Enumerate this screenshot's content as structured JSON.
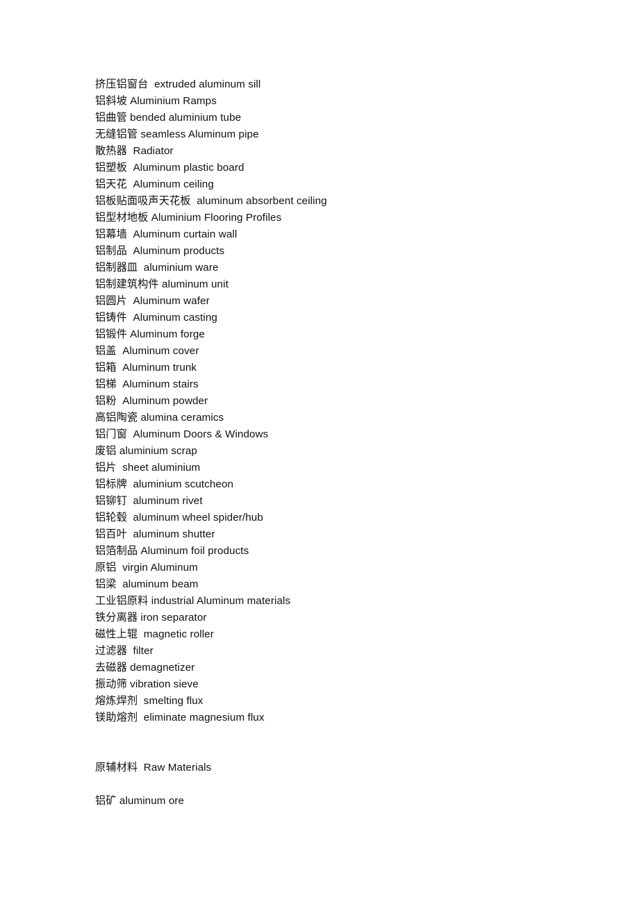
{
  "document": {
    "background_color": "#ffffff",
    "text_color": "#100f0f",
    "glossary": {
      "entries": [
        "挤压铝窗台  extruded aluminum sill",
        "铝斜坡 Aluminium Ramps",
        "铝曲管 bended aluminium tube",
        "无缝铝管 seamless Aluminum pipe",
        "散热器  Radiator",
        "铝塑板  Aluminum plastic board",
        "铝天花  Aluminum ceiling",
        "铝板贴面吸声天花板  aluminum absorbent ceiling",
        "铝型材地板 Aluminium Flooring Profiles",
        "铝幕墙  Aluminum curtain wall",
        "铝制品  Aluminum products",
        "铝制器皿  aluminium ware",
        "铝制建筑构件 aluminum unit",
        "铝圆片  Aluminum wafer",
        "铝铸件  Aluminum casting",
        "铝锻件 Aluminum forge",
        "铝盖  Aluminum cover",
        "铝箱  Aluminum trunk",
        "铝梯  Aluminum stairs",
        "铝粉  Aluminum powder",
        "高铝陶瓷 alumina ceramics",
        "铝门窗  Aluminum Doors & Windows",
        "废铝 aluminium scrap",
        "铝片  sheet aluminium",
        "铝标牌  aluminium scutcheon",
        "铝铆钉  aluminum rivet",
        "铝轮毂  aluminum wheel spider/hub",
        "铝百叶  aluminum shutter",
        "铝箔制品 Aluminum foil products",
        "原铝  virgin Aluminum",
        "铝梁  aluminum beam",
        "工业铝原料 industrial Aluminum materials",
        "铁分离器 iron separator",
        "磁性上辊  magnetic roller",
        "过滤器  filter",
        "去磁器 demagnetizer",
        "振动筛 vibration sieve",
        "熔炼焊剂  smelting flux",
        "镁助熔剂  eliminate magnesium flux"
      ]
    },
    "raw_materials_section": {
      "heading": "原辅材料  Raw Materials",
      "entries": [
        "铝矿 aluminum ore"
      ]
    }
  }
}
